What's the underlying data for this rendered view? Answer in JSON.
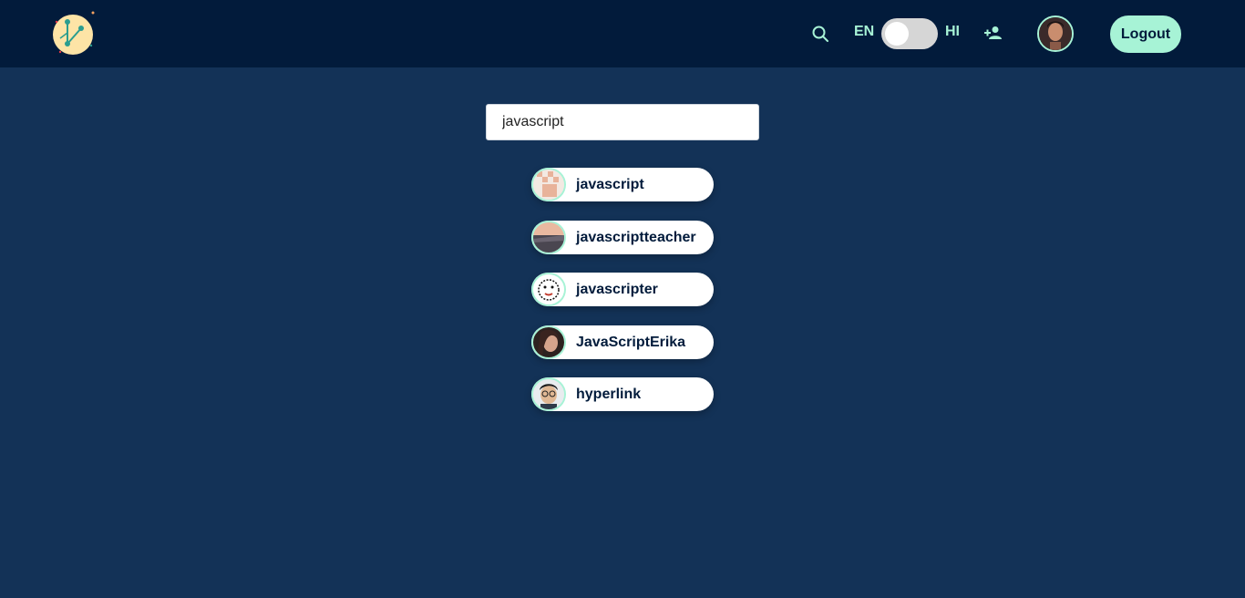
{
  "nav": {
    "language_left": "EN",
    "language_right": "HI",
    "language_toggle_on": false,
    "logout_label": "Logout",
    "accent": "#a7f3d6",
    "background": "#021b3b"
  },
  "search": {
    "value": "javascript"
  },
  "results": [
    {
      "name": "javascript",
      "avatar": "pixel-icon"
    },
    {
      "name": "javascriptteacher",
      "avatar": "landscape-photo"
    },
    {
      "name": "javascripter",
      "avatar": "drawn-face"
    },
    {
      "name": "JavaScriptErika",
      "avatar": "portrait-photo"
    },
    {
      "name": "hyperlink",
      "avatar": "portrait-glasses-photo"
    }
  ],
  "colors": {
    "page_background": "#133257",
    "accent": "#a7f3d6"
  }
}
